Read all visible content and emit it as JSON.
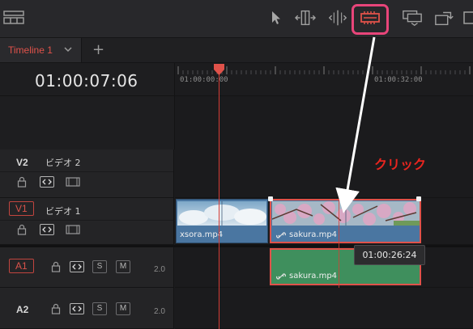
{
  "toolbar": {
    "tools": [
      {
        "name": "selection-icon"
      },
      {
        "name": "trim-edit-icon"
      },
      {
        "name": "dynamic-trim-icon"
      },
      {
        "name": "blade-edit-icon",
        "highlighted": true
      },
      {
        "name": "overwrite-icon"
      },
      {
        "name": "replace-icon"
      }
    ],
    "left_icon": "timeline-view-options-icon"
  },
  "tab": {
    "label": "Timeline 1",
    "add_label": "+"
  },
  "header": {
    "timecode": "01:00:07:06"
  },
  "ruler": {
    "labels": [
      "01:00:00:00",
      "01:00:32:00"
    ]
  },
  "tracks": {
    "v2": {
      "id": "V2",
      "name": "ビデオ 2"
    },
    "v1": {
      "id": "V1",
      "name": "ビデオ 1"
    },
    "a1": {
      "id": "A1",
      "solo": "S",
      "mute": "M",
      "volume": "2.0"
    },
    "a2": {
      "id": "A2",
      "solo": "S",
      "mute": "M",
      "volume": "2.0"
    }
  },
  "clips": {
    "xsora": "xsora.mp4",
    "sakura_video": "sakura.mp4",
    "sakura_audio": "sakura.mp4"
  },
  "annotation": {
    "click": "クリック"
  },
  "tooltip": {
    "timecode": "01:00:26:24"
  },
  "colors": {
    "accent_red": "#e0524a",
    "highlight_pink": "#e8457a",
    "video_clip": "#4a76a1",
    "audio_clip": "#3f8f5d",
    "playhead": "#d63d36"
  }
}
